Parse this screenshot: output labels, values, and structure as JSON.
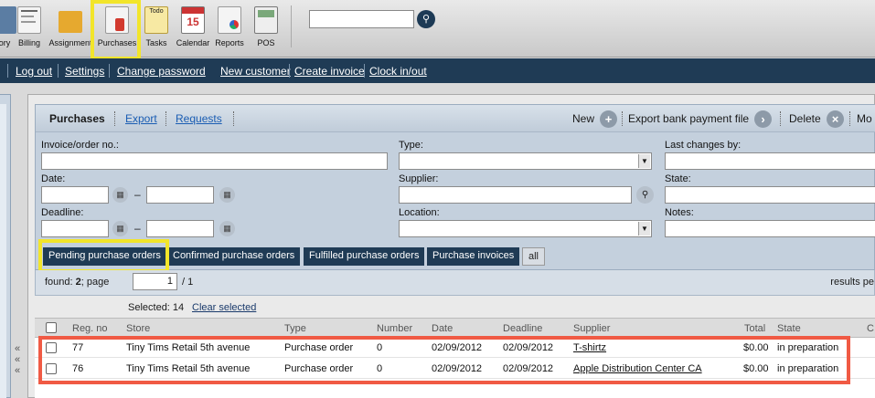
{
  "toolbar": {
    "items": [
      {
        "label": "ory",
        "icon": "directory-icon"
      },
      {
        "label": "Billing",
        "icon": "billing-icon"
      },
      {
        "label": "Assignment",
        "icon": "folder-icon"
      },
      {
        "label": "Purchases",
        "icon": "purchases-icon"
      },
      {
        "label": "Tasks",
        "icon": "todo-icon"
      },
      {
        "label": "Calendar",
        "icon": "calendar-icon"
      },
      {
        "label": "Reports",
        "icon": "reports-icon"
      },
      {
        "label": "POS",
        "icon": "pos-icon"
      }
    ],
    "search_placeholder": "",
    "calendar_day": "15",
    "tasks_icon_text": "Todo"
  },
  "nav": {
    "links": [
      "Log out",
      "Settings",
      "Change password",
      "New customer",
      "Create invoice",
      "Clock in/out"
    ]
  },
  "panel": {
    "title": "Purchases",
    "links": [
      "Export",
      "Requests"
    ],
    "actions": {
      "new": "New",
      "export_bank": "Export bank payment file",
      "delete": "Delete",
      "more": "Mo"
    }
  },
  "filters": {
    "invoice_label": "Invoice/order no.:",
    "type_label": "Type:",
    "last_changes_label": "Last changes by:",
    "date_label": "Date:",
    "supplier_label": "Supplier:",
    "state_label": "State:",
    "deadline_label": "Deadline:",
    "location_label": "Location:",
    "notes_label": "Notes:",
    "range_dash": "–"
  },
  "tabs": [
    "Pending purchase orders",
    "Confirmed purchase orders",
    "Fulfilled purchase orders",
    "Purchase invoices",
    "all"
  ],
  "pager": {
    "found_prefix": "found: ",
    "found_count": "2",
    "page_label": "; page",
    "page_value": "1",
    "page_total": "/ 1",
    "results_per": "results pe"
  },
  "selection": {
    "selected_text": "Selected: 14",
    "clear_label": "Clear selected"
  },
  "table": {
    "columns": [
      "Reg. no",
      "Store",
      "Type",
      "Number",
      "Date",
      "Deadline",
      "Supplier",
      "Total",
      "State",
      "C"
    ],
    "rows": [
      {
        "reg_no": "77",
        "store": "Tiny Tims Retail 5th avenue",
        "type": "Purchase order",
        "number": "0",
        "date": "02/09/2012",
        "deadline": "02/09/2012",
        "supplier": "T-shirtz",
        "total": "$0.00",
        "state": "in preparation"
      },
      {
        "reg_no": "76",
        "store": "Tiny Tims Retail 5th avenue",
        "type": "Purchase order",
        "number": "0",
        "date": "02/09/2012",
        "deadline": "02/09/2012",
        "supplier": "Apple Distribution Center CA",
        "total": "$0.00",
        "state": "in preparation"
      }
    ]
  },
  "colors": {
    "navbar": "#1f3b55",
    "highlight_yellow": "#f2e52a",
    "highlight_red": "#f05a44",
    "link_blue": "#1a5db3"
  }
}
